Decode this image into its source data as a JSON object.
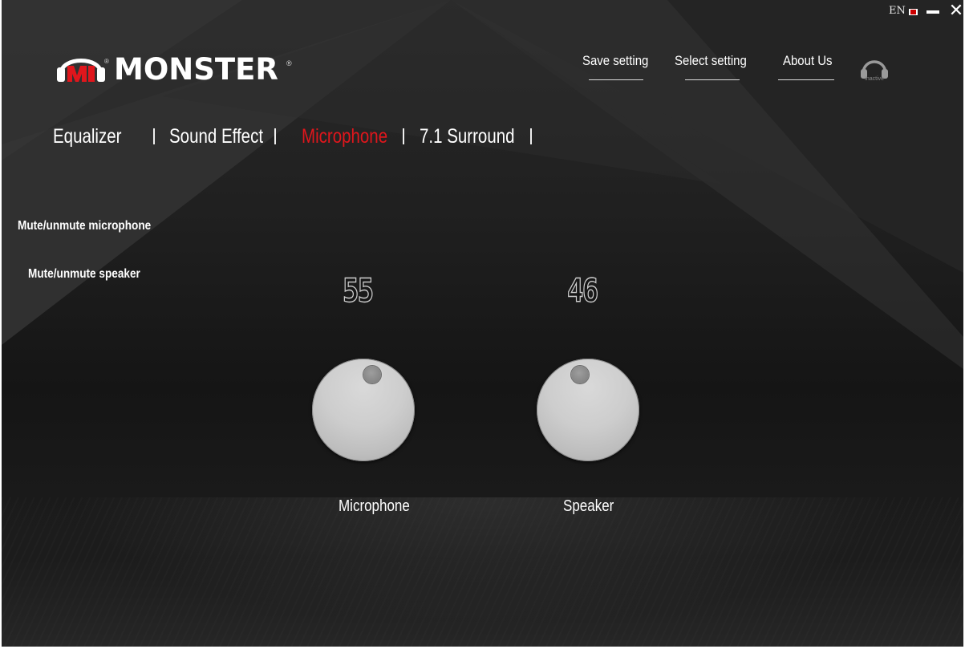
{
  "window": {
    "language": "EN",
    "minimize_icon": "minimize-icon",
    "close_icon": "close-icon"
  },
  "brand": {
    "name": "MONSTER",
    "registered": "®"
  },
  "header": {
    "save_setting": "Save setting",
    "select_setting": "Select setting",
    "about_us": "About Us",
    "device_icon": "headset-icon",
    "device_status": "Inactive"
  },
  "tabs": [
    {
      "label": "Equalizer",
      "active": false
    },
    {
      "label": "Sound Effect",
      "active": false
    },
    {
      "label": "Microphone",
      "active": true
    },
    {
      "label": "7.1 Surround",
      "active": false
    }
  ],
  "options": {
    "mute_microphone": "Mute/unmute microphone",
    "mute_speaker": "Mute/unmute speaker"
  },
  "controls": {
    "microphone": {
      "value": "55",
      "label": "Microphone"
    },
    "speaker": {
      "value": "46",
      "label": "Speaker"
    }
  },
  "colors": {
    "accent": "#e0161c",
    "text": "#ffffff",
    "background": "#1b1b1b",
    "knob": "#c8c8c8"
  }
}
